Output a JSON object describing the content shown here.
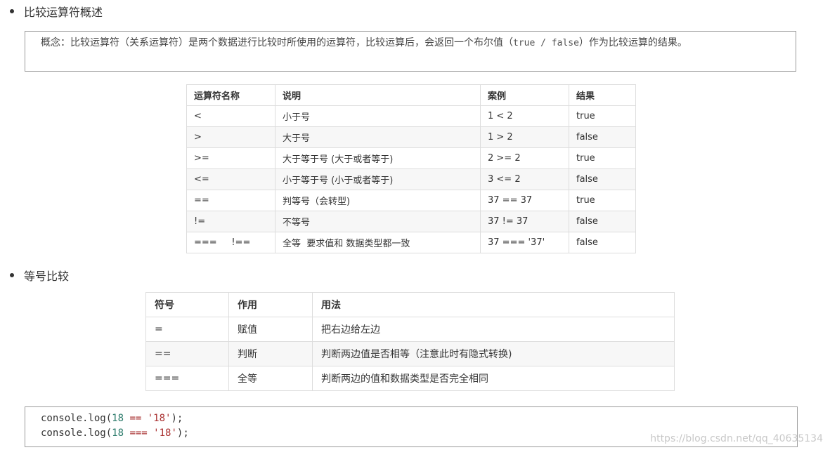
{
  "section1": {
    "title": "比较运算符概述",
    "concept": "概念：比较运算符（关系运算符）是两个数据进行比较时所使用的运算符，比较运算后，会返回一个布尔值（",
    "concept_code": "true / false",
    "concept_end": "）作为比较运算的结果。"
  },
  "table1": {
    "headers": [
      "运算符名称",
      "说明",
      "案例",
      "结果"
    ],
    "rows": [
      [
        "<",
        "小于号",
        "1 < 2",
        "true"
      ],
      [
        ">",
        "大于号",
        "1 > 2",
        "false"
      ],
      [
        ">=",
        "大于等于号 (大于或者等于)",
        "2 >= 2",
        "true"
      ],
      [
        "<=",
        "小于等于号 (小于或者等于)",
        "3 <= 2",
        "false"
      ],
      [
        "==",
        "判等号（会转型)",
        "37 == 37",
        "true"
      ],
      [
        "!=",
        "不等号",
        "37 != 37",
        "false"
      ],
      [
        "===     !==",
        "全等  要求值和 数据类型都一致",
        "37 === '37'",
        "false"
      ]
    ]
  },
  "section2": {
    "title": "等号比较"
  },
  "table2": {
    "headers": [
      "符号",
      "作用",
      "用法"
    ],
    "rows": [
      [
        "=",
        "赋值",
        "把右边给左边"
      ],
      [
        "==",
        "判断",
        "判断两边值是否相等（注意此时有隐式转换)"
      ],
      [
        "===",
        "全等",
        "判断两边的值和数据类型是否完全相同"
      ]
    ]
  },
  "code": {
    "line1": {
      "fn": "console.log(",
      "num": "18",
      "op": " == ",
      "str": "'18'",
      "end": ");"
    },
    "line2": {
      "fn": "console.log(",
      "num": "18",
      "op": " === ",
      "str": "'18'",
      "end": ");"
    }
  },
  "watermark": "https://blog.csdn.net/qq_40635134"
}
